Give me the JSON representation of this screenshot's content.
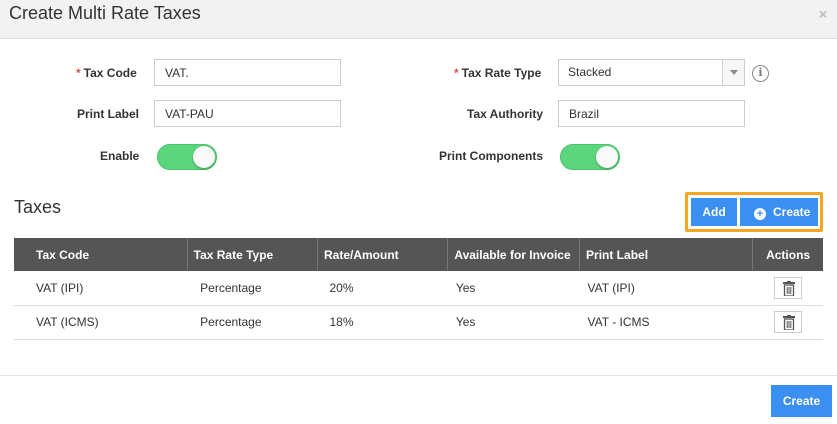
{
  "dialog": {
    "title": "Create Multi Rate Taxes",
    "close_label": "×"
  },
  "form": {
    "required_marker": "*",
    "tax_code": {
      "label": "Tax Code",
      "value": "VAT."
    },
    "print_label": {
      "label": "Print Label",
      "value": "VAT-PAU"
    },
    "enable": {
      "label": "Enable",
      "checked": true
    },
    "tax_rate_type": {
      "label": "Tax Rate Type",
      "value": "Stacked"
    },
    "tax_authority": {
      "label": "Tax Authority",
      "value": "Brazil"
    },
    "print_components": {
      "label": "Print Components",
      "checked": true
    },
    "info_icon": "i"
  },
  "taxes": {
    "title": "Taxes",
    "add_label": "Add",
    "create_label": "Create",
    "columns": [
      "Tax Code",
      "Tax Rate Type",
      "Rate/Amount",
      "Available for Invoice",
      "Print Label",
      "Actions"
    ],
    "rows": [
      {
        "tax_code": "VAT (IPI)",
        "tax_rate_type": "Percentage",
        "rate": "20%",
        "available": "Yes",
        "print_label": "VAT (IPI)"
      },
      {
        "tax_code": "VAT (ICMS)",
        "tax_rate_type": "Percentage",
        "rate": "18%",
        "available": "Yes",
        "print_label": "VAT - ICMS"
      }
    ]
  },
  "footer": {
    "create_label": "Create"
  },
  "colors": {
    "primary": "#3b8ff0",
    "toggle_on": "#5cd67e",
    "highlight": "#f5a623",
    "table_header": "#555555",
    "required": "#d9534f"
  },
  "icons": {
    "close": "close-icon",
    "info": "info-icon",
    "plus": "plus-circle-icon",
    "trash": "trash-icon",
    "dropdown": "chevron-down-icon"
  }
}
